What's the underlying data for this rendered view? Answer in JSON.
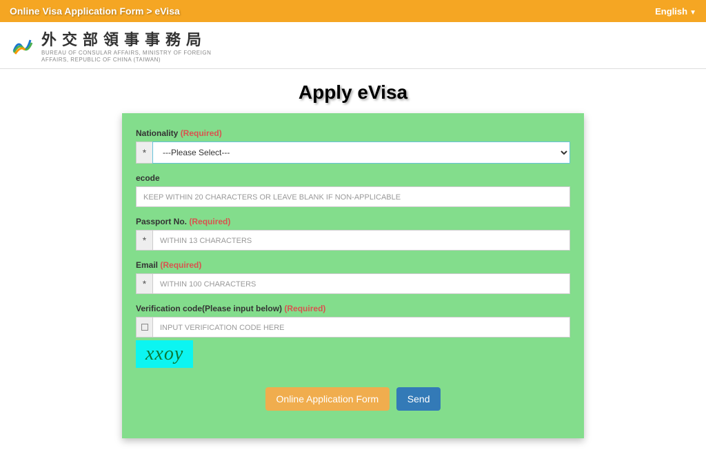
{
  "topbar": {
    "breadcrumb": "Online Visa Application Form > eVisa",
    "language": "English"
  },
  "header": {
    "title_cn": "外交部領事事務局",
    "title_en_line1": "BUREAU OF CONSULAR AFFAIRS, MINISTRY OF FOREIGN",
    "title_en_line2": "AFFAIRS, REPUBLIC OF CHINA (TAIWAN)"
  },
  "page": {
    "title": "Apply eVisa"
  },
  "form": {
    "required_label": "(Required)",
    "nationality": {
      "label": "Nationality",
      "required": true,
      "selected": "---Please Select---"
    },
    "ecode": {
      "label": "ecode",
      "required": false,
      "placeholder": "KEEP WITHIN 20 CHARACTERS OR LEAVE BLANK IF NON-APPLICABLE"
    },
    "passport": {
      "label": "Passport No.",
      "required": true,
      "placeholder": "WITHIN 13 CHARACTERS"
    },
    "email": {
      "label": "Email",
      "required": true,
      "placeholder": "WITHIN 100 CHARACTERS"
    },
    "verification": {
      "label": "Verification code(Please input below)",
      "required": true,
      "placeholder": "Input verification code here",
      "captcha_text": "xxoy"
    }
  },
  "buttons": {
    "online_form": "Online Application Form",
    "send": "Send"
  }
}
